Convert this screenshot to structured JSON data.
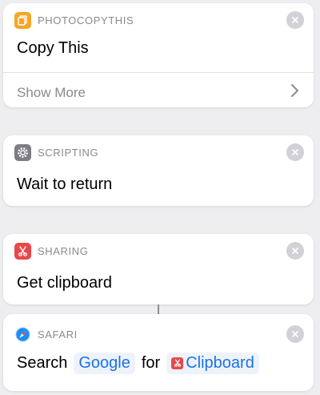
{
  "colors": {
    "background": "#eeeef1",
    "card": "#ffffff",
    "link_blue": "#1a73e8",
    "muted_gray": "#8a8a8f"
  },
  "actions": [
    {
      "app": "PHOTOCOPYTHIS",
      "title": "Copy This",
      "icon": "photocopy-app-icon",
      "show_more": "Show More"
    },
    {
      "app": "SCRIPTING",
      "title": "Wait to return",
      "icon": "gear-icon"
    },
    {
      "app": "SHARING",
      "title": "Get clipboard",
      "icon": "scissors-icon"
    },
    {
      "app": "SAFARI",
      "icon": "safari-compass-icon",
      "params": {
        "prefix": "Search",
        "engine": "Google",
        "connector": "for",
        "input": "Clipboard"
      }
    }
  ]
}
